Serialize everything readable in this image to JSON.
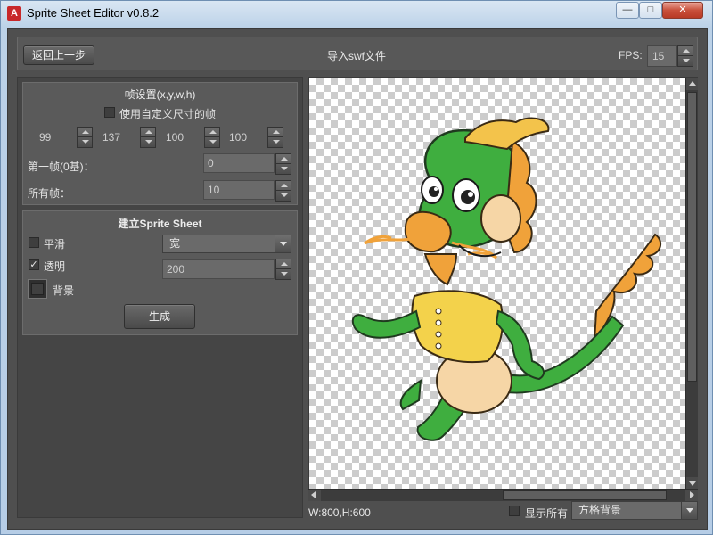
{
  "window": {
    "title": "Sprite Sheet Editor v0.8.2",
    "min_glyph": "—",
    "max_glyph": "□",
    "close_glyph": "✕",
    "app_icon_glyph": "A"
  },
  "toolbar": {
    "back_label": "返回上一步",
    "import_label": "导入swf文件",
    "fps_label": "FPS:",
    "fps_value": "15"
  },
  "frame_settings": {
    "title": "帧设置(x,y,w,h)",
    "custom_size_label": "使用自定义尺寸的帧",
    "custom_size_checked": false,
    "x": "99",
    "y": "137",
    "w": "100",
    "h": "100",
    "first_frame_label": "第一帧(0基)：",
    "first_frame_value": "0",
    "all_frames_label": "所有帧：",
    "all_frames_value": "10"
  },
  "sprite_sheet": {
    "title": "建立Sprite Sheet",
    "smooth_label": "平滑",
    "smooth_checked": false,
    "layout_value": "宽",
    "transparent_label": "透明",
    "transparent_checked": true,
    "width_value": "200",
    "background_label": "背景",
    "generate_label": "生成"
  },
  "canvas": {
    "subject_icon": "green-dragon-mascot"
  },
  "status": {
    "size_text": "W:800,H:600",
    "show_all_label": "显示所有",
    "show_all_checked": false,
    "background_mode": "方格背景"
  },
  "colors": {
    "panel_bg": "#4f4f4f",
    "dragon_green": "#3fae3f",
    "dragon_orange": "#f0a23a",
    "vest_yellow": "#f3d24b"
  }
}
